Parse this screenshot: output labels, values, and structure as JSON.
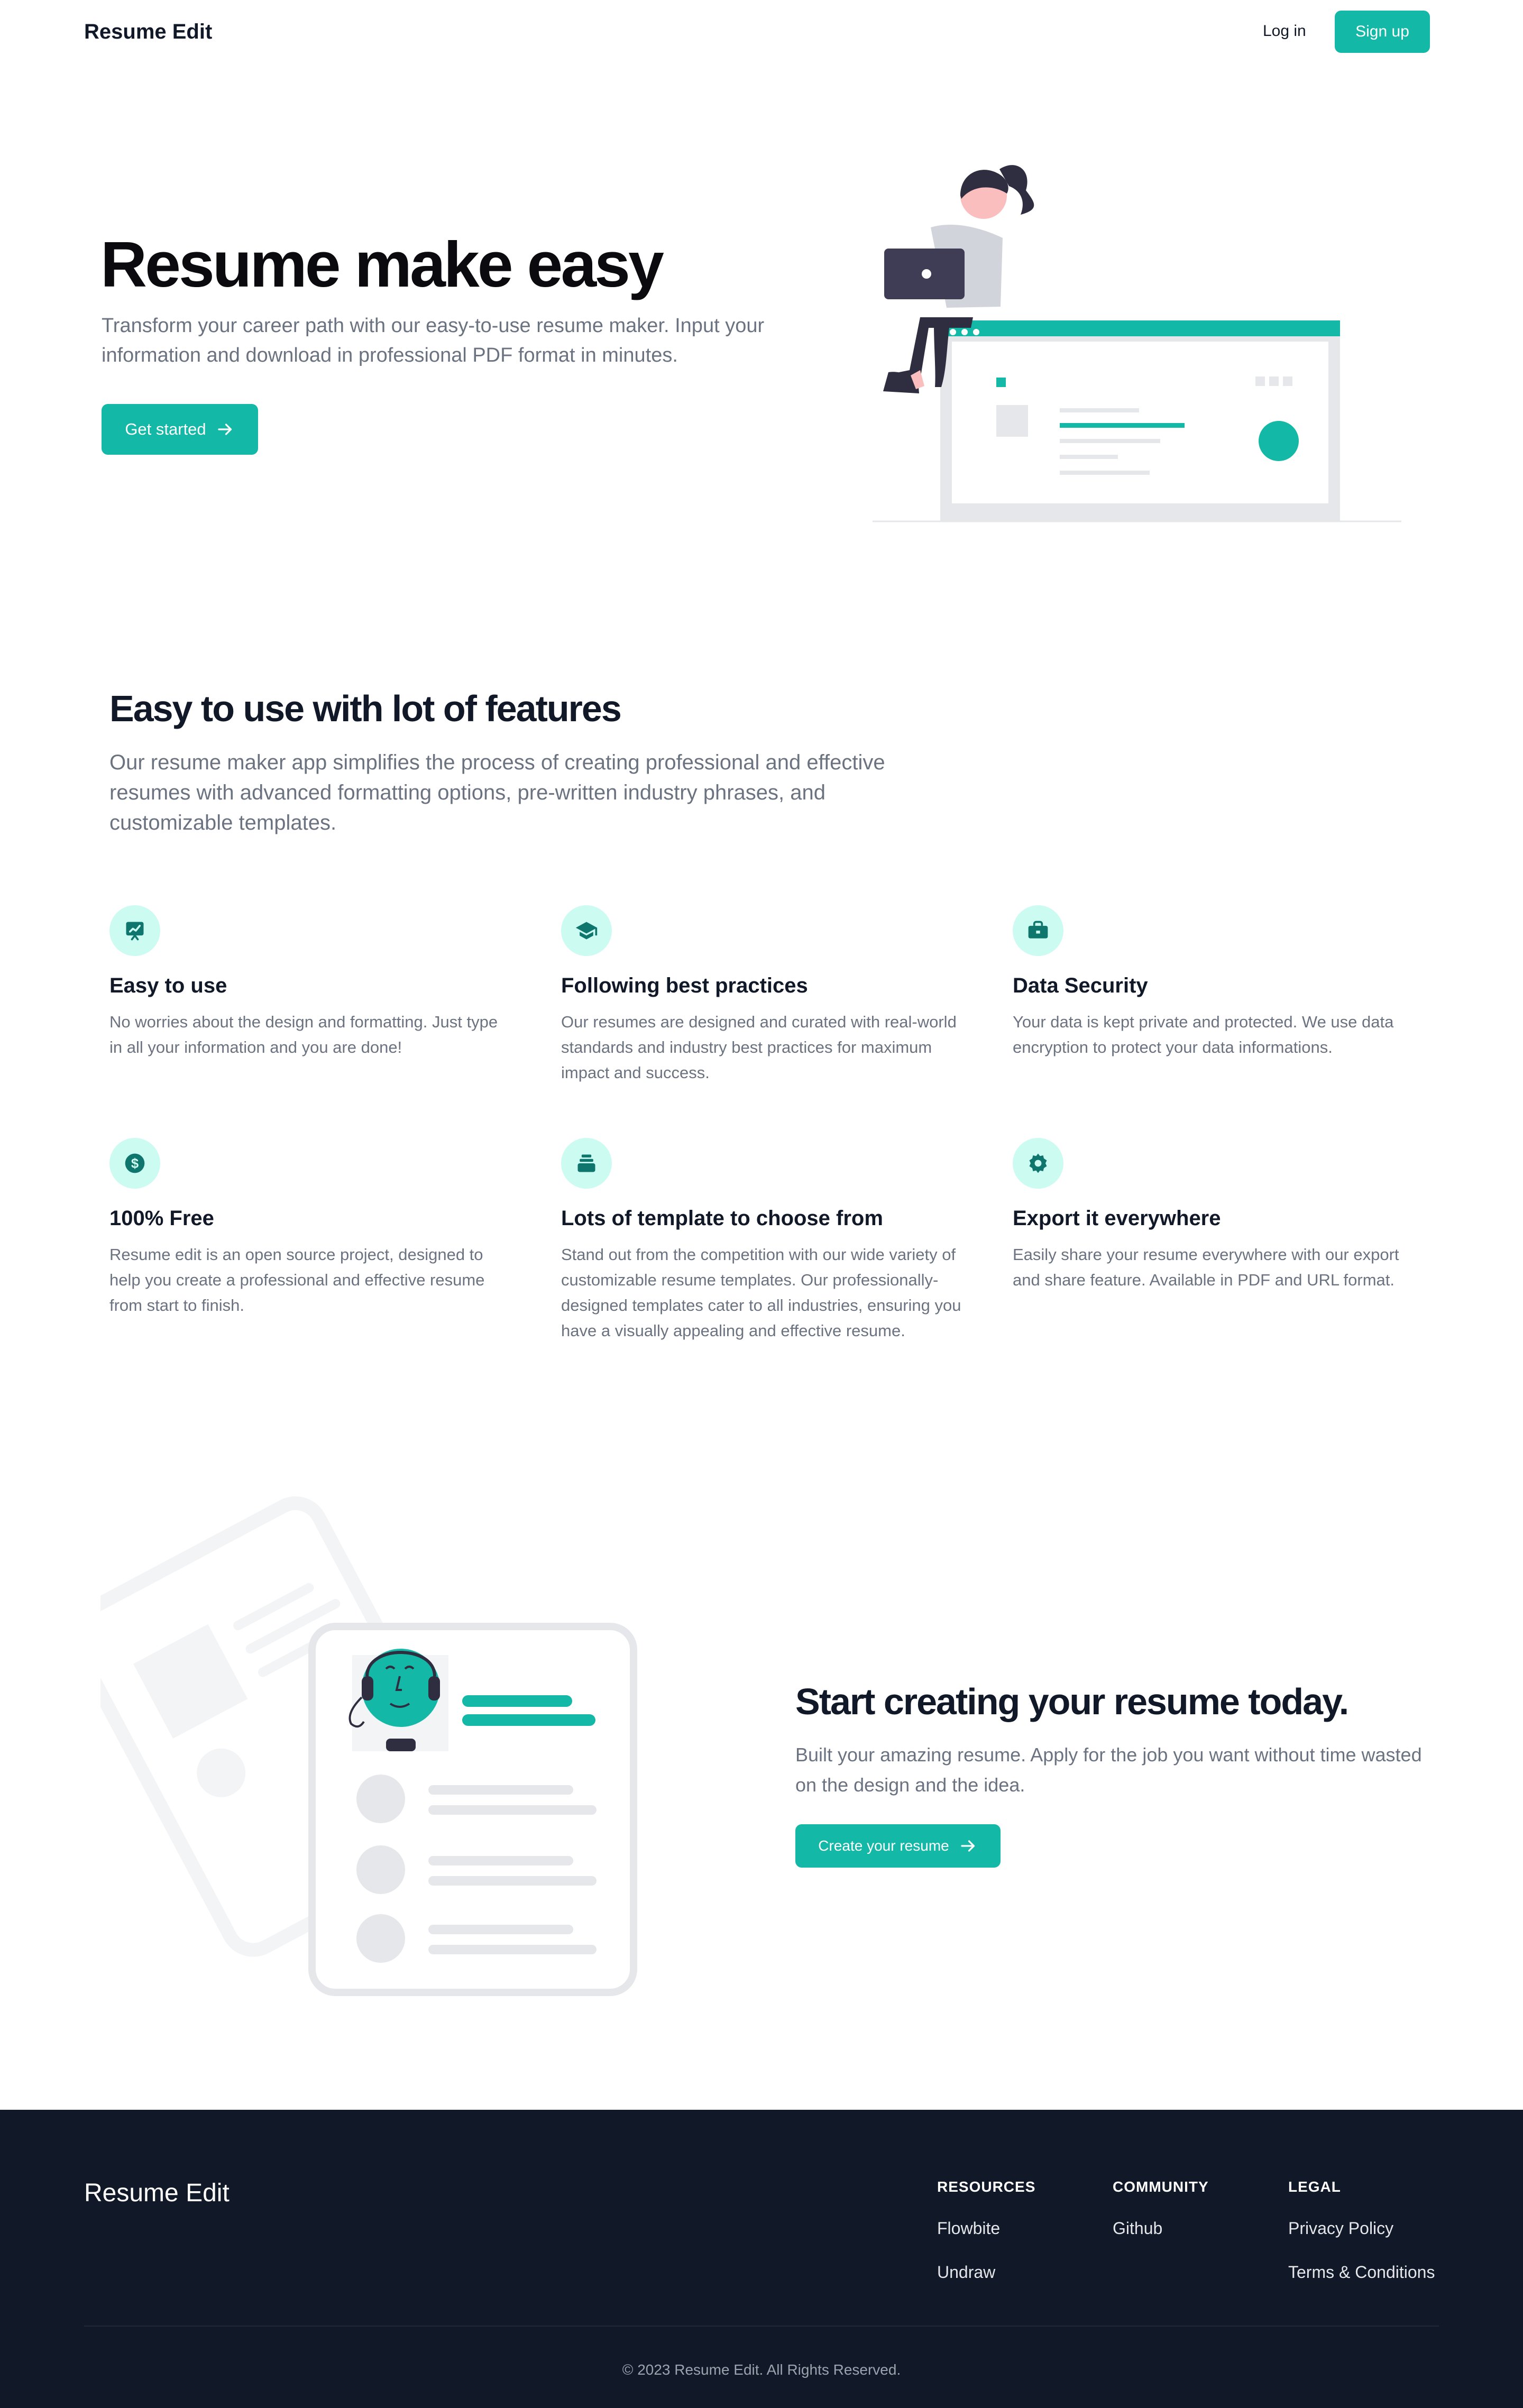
{
  "nav": {
    "brand": "Resume Edit",
    "login": "Log in",
    "signup": "Sign up"
  },
  "hero": {
    "title": "Resume make easy",
    "subtitle": "Transform your career path with our easy-to-use resume maker. Input your information and download in professional PDF format in minutes.",
    "cta": "Get started",
    "cta_icon": "arrow-right-icon"
  },
  "features": {
    "title": "Easy to use with lot of features",
    "subtitle": "Our resume maker app simplifies the process of creating professional and effective resumes with advanced formatting options, pre-written industry phrases, and customizable templates.",
    "items": [
      {
        "icon": "presentation-chart-icon",
        "title": "Easy to use",
        "desc": "No worries about the design and formatting. Just type in all your information and you are done!"
      },
      {
        "icon": "graduation-cap-icon",
        "title": "Following best practices",
        "desc": "Our resumes are designed and curated with real-world standards and industry best practices for maximum impact and success."
      },
      {
        "icon": "briefcase-icon",
        "title": "Data Security",
        "desc": "Your data is kept private and protected. We use data encryption to protect your data informations."
      },
      {
        "icon": "dollar-icon",
        "title": "100% Free",
        "desc": "Resume edit is an open source project, designed to help you create a professional and effective resume from start to finish."
      },
      {
        "icon": "template-stack-icon",
        "title": "Lots of template to choose from",
        "desc": "Stand out from the competition with our wide variety of customizable resume templates. Our professionally-designed templates cater to all industries, ensuring you have a visually appealing and effective resume."
      },
      {
        "icon": "gear-icon",
        "title": "Export it everywhere",
        "desc": "Easily share your resume everywhere with our export and share feature. Available in PDF and URL format."
      }
    ]
  },
  "cta_section": {
    "title": "Start creating your resume today.",
    "subtitle": "Built your amazing resume. Apply for the job you want without time wasted on the design and the idea.",
    "button": "Create your resume"
  },
  "footer": {
    "brand": "Resume Edit",
    "columns": [
      {
        "title": "RESOURCES",
        "links": [
          "Flowbite",
          "Undraw"
        ]
      },
      {
        "title": "COMMUNITY",
        "links": [
          "Github"
        ]
      },
      {
        "title": "LEGAL",
        "links": [
          "Privacy Policy",
          "Terms & Conditions"
        ]
      }
    ],
    "copyright": "© 2023 Resume Edit. All Rights Reserved."
  },
  "colors": {
    "accent": "#14b8a6",
    "accent_light": "#ccfbf1",
    "footer_bg": "#111827",
    "text_muted": "#6b7280"
  }
}
